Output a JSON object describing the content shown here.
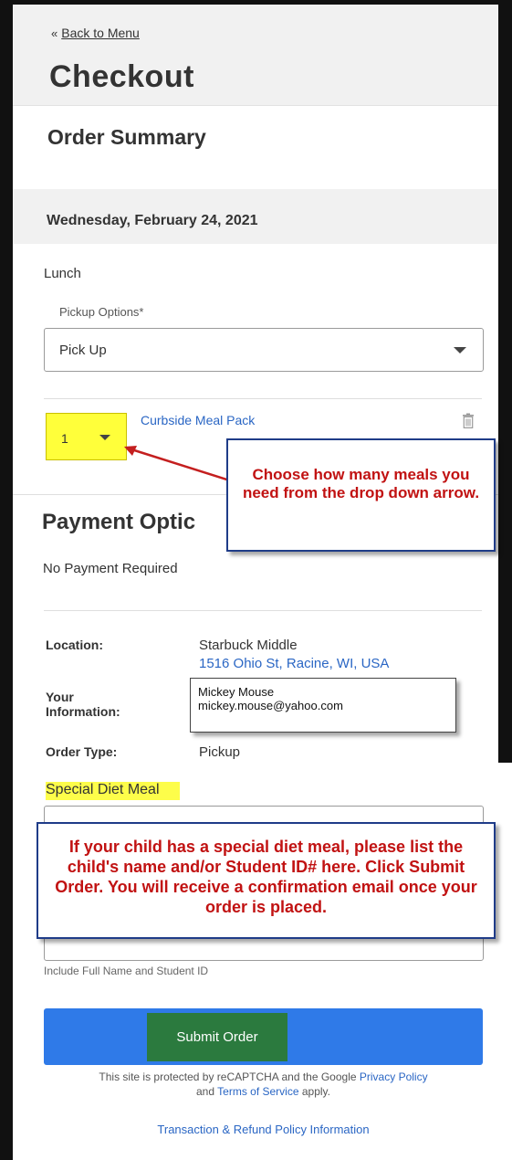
{
  "header": {
    "back_chevron": "«",
    "back_label": "Back to Menu",
    "title": "Checkout"
  },
  "order_summary": {
    "title": "Order Summary",
    "date": "Wednesday, February 24, 2021",
    "meal": "Lunch",
    "pickup_label": "Pickup Options*",
    "pickup_value": "Pick Up",
    "item": {
      "quantity": "1",
      "name": "Curbside Meal Pack"
    }
  },
  "callouts": {
    "quantity_hint": "Choose how many meals you need from the drop down arrow.",
    "diet_hint": "If your child has a special diet meal, please list the child's name and/or Student ID# here. Click Submit Order. You will receive a confirmation email once your order is placed."
  },
  "payment": {
    "title": "Payment Optic",
    "text": "No Payment Required"
  },
  "details": {
    "location_label": "Location:",
    "location_name": "Starbuck Middle",
    "location_address": "1516 Ohio St, Racine, WI, USA",
    "info_label_line1": "Your",
    "info_label_line2": "Information:",
    "info_name": "Mickey Mouse",
    "info_email": "mickey.mouse@yahoo.com",
    "order_type_label": "Order Type:",
    "order_type_value": "Pickup"
  },
  "special_diet": {
    "label": "Special Diet Meal",
    "helper": "Include Full Name and Student ID"
  },
  "submit": {
    "label": "Submit Order"
  },
  "footer": {
    "recaptcha_prefix": "This site is protected by reCAPTCHA and the Google",
    "privacy_link": "Privacy Policy",
    "recaptcha_and": "and",
    "terms_link": "Terms of Service",
    "recaptcha_suffix": "apply.",
    "refund_link": "Transaction & Refund Policy Information"
  },
  "colors": {
    "link": "#2a66c4",
    "highlight": "#ffff3a",
    "submit_bar": "#2f7ae8",
    "submit_button": "#2b7a3e",
    "callout_text": "#c11212",
    "callout_border": "#1f3c88"
  }
}
